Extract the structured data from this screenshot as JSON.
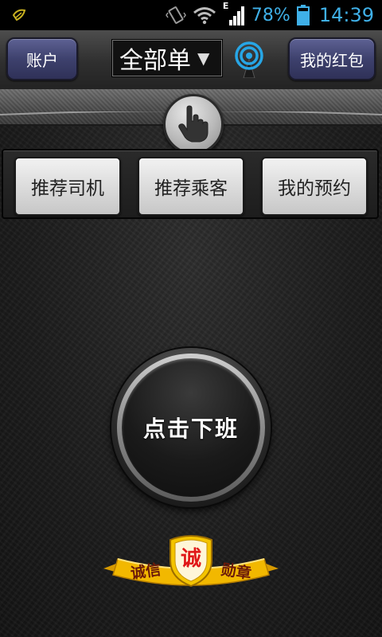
{
  "status_bar": {
    "battery_percent": "78%",
    "time": "14:39",
    "network_label": "E",
    "colors": {
      "text": "#3fb0e8"
    }
  },
  "header": {
    "account_label": "账户",
    "filter_selected": "全部单",
    "filter_arrow": "▼",
    "redpacket_label": "我的红包"
  },
  "tabs": [
    {
      "label": "推荐司机"
    },
    {
      "label": "推荐乘客"
    },
    {
      "label": "我的预约"
    }
  ],
  "main_button": {
    "label": "点击下班"
  },
  "badge": {
    "left_text": "诚信",
    "center_text": "诚",
    "right_text": "勋章"
  },
  "colors": {
    "nav_button": "#3e416d",
    "badge_ribbon": "#f2b800",
    "badge_text": "#6b1a0a",
    "shield_text": "#e01818"
  }
}
